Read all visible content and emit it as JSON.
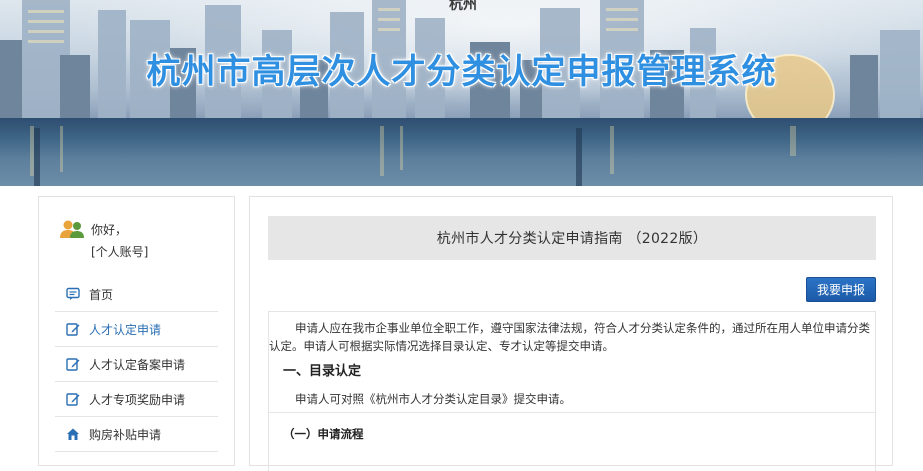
{
  "banner": {
    "title": "杭州市高层次人才分类认定申报管理系统",
    "top_logo": "杭州",
    "title_color": "#2f8fe0"
  },
  "sidebar": {
    "greeting": "你好，",
    "account": "[个人账号]",
    "avatar_icon": "user-group-icon",
    "items": [
      {
        "label": "首页",
        "icon": "chat-bubble-icon",
        "active": false
      },
      {
        "label": "人才认定申请",
        "icon": "edit-icon",
        "active": true
      },
      {
        "label": "人才认定备案申请",
        "icon": "edit-icon",
        "active": false
      },
      {
        "label": "人才专项奖励申请",
        "icon": "edit-icon",
        "active": false
      },
      {
        "label": "购房补贴申请",
        "icon": "home-icon",
        "active": false
      }
    ],
    "active_color": "#2a6fb4"
  },
  "main": {
    "guide_title": "杭州市人才分类认定申请指南 （2022版）",
    "apply_button": "我要申报",
    "intro_paragraph": "申请人应在我市企事业单位全职工作，遵守国家法律法规，符合人才分类认定条件的，通过所在用人单位申请分类认定。申请人可根据实际情况选择目录认定、专才认定等提交申请。",
    "section1_heading": "一、目录认定",
    "section1_text": "申请人可对照《杭州市人才分类认定目录》提交申请。",
    "subsection_heading": "（一）申请流程",
    "accent_color": "#1b5aa8"
  }
}
